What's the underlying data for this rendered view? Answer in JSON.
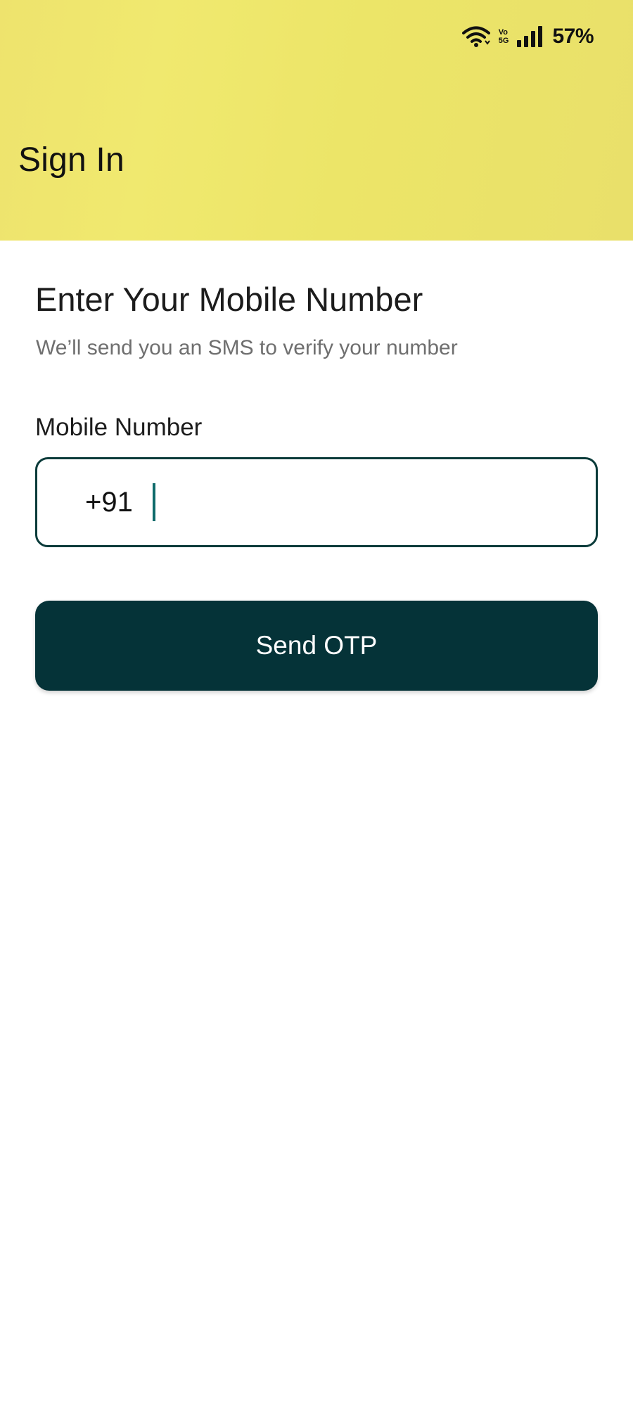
{
  "status_bar": {
    "battery": "57%",
    "icons": [
      "wifi-icon",
      "volte-5g-icon",
      "signal-icon"
    ],
    "network_top": "Vo",
    "network_bottom": "5G"
  },
  "header": {
    "title": "Sign In",
    "background_color": "#ece568"
  },
  "form": {
    "heading": "Enter Your Mobile Number",
    "subheading": "We’ll send you an SMS to verify your number",
    "mobile_label": "Mobile Number",
    "country_code": "+91",
    "mobile_value": "",
    "border_color": "#0b3b3a"
  },
  "actions": {
    "send_otp_label": "Send OTP",
    "button_color": "#053338"
  }
}
